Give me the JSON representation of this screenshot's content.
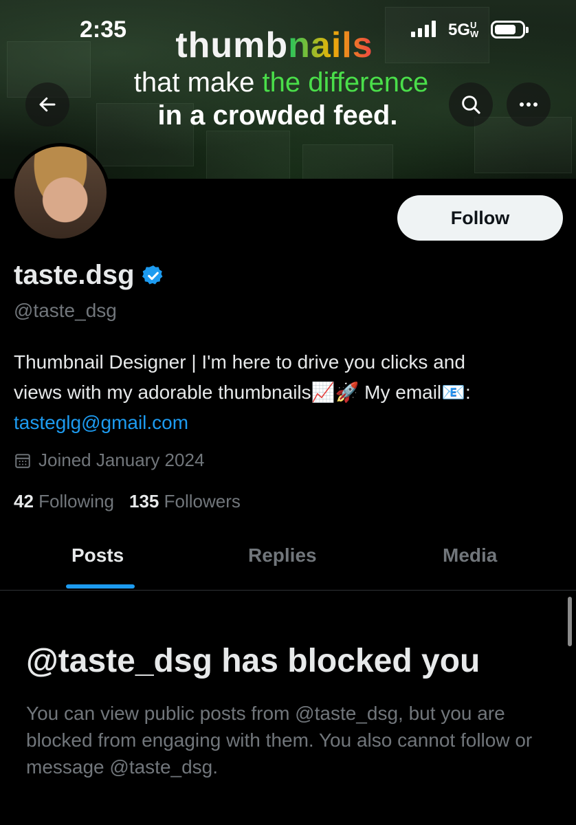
{
  "status_bar": {
    "time": "2:35",
    "network": "5G",
    "network_suffix": "UW"
  },
  "banner": {
    "line1_prefix": "thumb",
    "line1_accent": "nails",
    "line2_prefix": "that make ",
    "line2_highlight": "the difference",
    "line3": "in a crowded feed."
  },
  "actions": {
    "follow_label": "Follow"
  },
  "profile": {
    "display_name": "taste.dsg",
    "handle": "@taste_dsg",
    "bio_line1": "Thumbnail Designer | I'm here to drive you clicks and",
    "bio_line2": "views with my adorable thumbnails📈🚀 My email📧:",
    "email": "tasteglg@gmail.com",
    "joined": "Joined January 2024",
    "following_count": "42",
    "following_label": "Following",
    "followers_count": "135",
    "followers_label": "Followers"
  },
  "tabs": [
    {
      "label": "Posts",
      "active": true
    },
    {
      "label": "Replies",
      "active": false
    },
    {
      "label": "Media",
      "active": false
    }
  ],
  "blocked": {
    "title": "@taste_dsg has blocked you",
    "description": "You can view public posts from @taste_dsg, but you are blocked from engaging with them. You also cannot follow or message @taste_dsg."
  },
  "colors": {
    "accent_blue": "#1d9bf0",
    "follow_bg": "#eff3f4",
    "muted_text": "#71767b",
    "banner_highlight": "#4ade4a"
  },
  "icons": [
    "back-arrow-icon",
    "search-icon",
    "more-icon",
    "verified-badge-icon",
    "calendar-icon",
    "signal-icon",
    "battery-icon"
  ]
}
